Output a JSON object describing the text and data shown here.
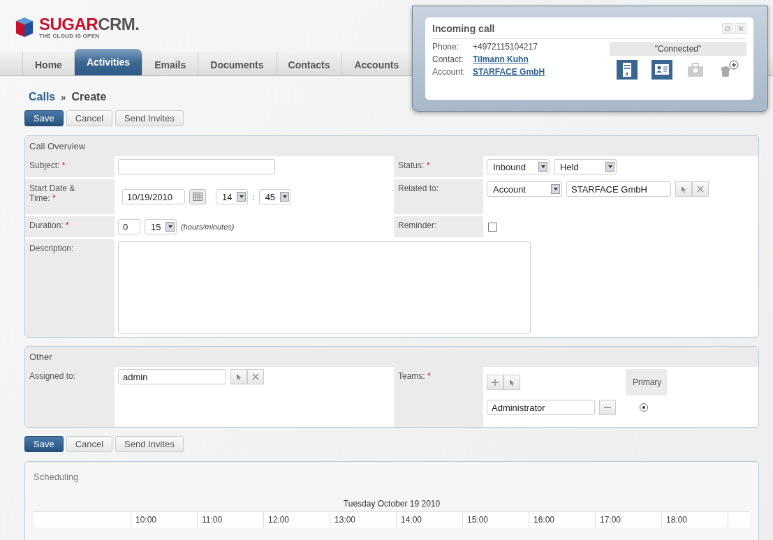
{
  "logo": {
    "brand_a": "SUGAR",
    "brand_b": "CRM.",
    "tagline": "THE CLOUD IS OPEN"
  },
  "tabs": [
    {
      "label": "Home",
      "selected": false
    },
    {
      "label": "Activities",
      "selected": true
    },
    {
      "label": "Emails",
      "selected": false
    },
    {
      "label": "Documents",
      "selected": false
    },
    {
      "label": "Contacts",
      "selected": false
    },
    {
      "label": "Accounts",
      "selected": false
    }
  ],
  "breadcrumb": {
    "parent": "Calls",
    "separator": "»",
    "current": "Create"
  },
  "actions": [
    "Save",
    "Cancel",
    "Send Invites"
  ],
  "call_overview": {
    "title": "Call Overview",
    "subject": {
      "label": "Subject:",
      "required": "*"
    },
    "start": {
      "label_a": "Start Date &",
      "label_b": "Time:",
      "required": "*",
      "date": "10/19/2010",
      "hour": "14",
      "sep": ":",
      "minute": "45"
    },
    "duration": {
      "label": "Duration:",
      "required": "*",
      "hours": "0",
      "minutes": "15",
      "hint": "(hours/minutes)"
    },
    "description": {
      "label": "Description:"
    },
    "status": {
      "label": "Status:",
      "required": "*",
      "direction": "Inbound",
      "state": "Held"
    },
    "related": {
      "label": "Related to:",
      "type": "Account",
      "value": "STARFACE GmbH"
    },
    "reminder": {
      "label": "Reminder:",
      "checked": false
    }
  },
  "other": {
    "title": "Other",
    "assigned": {
      "label": "Assigned to:",
      "value": "admin"
    },
    "teams": {
      "label": "Teams:",
      "required": "*",
      "primary_header": "Primary",
      "rows": [
        {
          "value": "Administrator",
          "selected": true
        }
      ]
    }
  },
  "actions_bottom": [
    "Save",
    "Cancel",
    "Send Invites"
  ],
  "scheduling": {
    "title": "Scheduling",
    "date": "Tuesday October 19 2010",
    "hours": [
      "10:00",
      "11:00",
      "12:00",
      "13:00",
      "14:00",
      "15:00",
      "16:00",
      "17:00",
      "18:00"
    ]
  },
  "popup": {
    "title": "Incoming call",
    "phone_label": "Phone:",
    "phone": "+4972115104217",
    "contact_label": "Contact:",
    "contact": "Tilmann Kuhn",
    "account_label": "Account:",
    "account": "STARFACE GmbH",
    "status": "\"Connected\""
  }
}
